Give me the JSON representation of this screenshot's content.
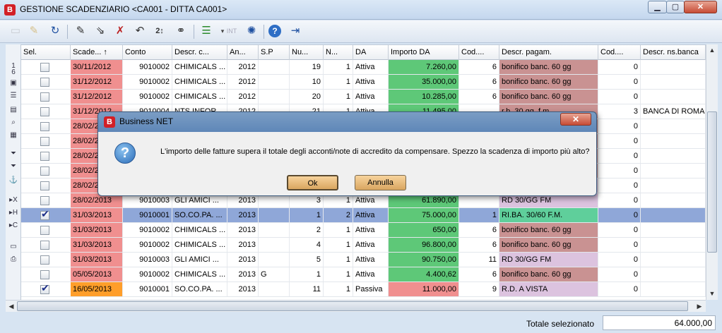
{
  "window": {
    "title": "GESTIONE SCADENZIARIO <CA001 - DITTA CA001>",
    "app_icon": "B",
    "min_label": "▁",
    "max_label": "▢",
    "close_label": "✕"
  },
  "left_strip": {
    "top_number_a": "1",
    "top_number_b": "6"
  },
  "columns": [
    "Sel.",
    "Scade... ↑",
    "Conto",
    "Descr. c...",
    "An...",
    "S.P",
    "Nu...",
    "N...",
    "DA",
    "Importo DA",
    "Cod....",
    "Descr. pagam.",
    "Cod....",
    "Descr. ns.banca"
  ],
  "rows": [
    {
      "sel": false,
      "date": "30/11/2012",
      "date_color": "red",
      "conto": "9010002",
      "descr": "CHIMICALS ...",
      "anno": "2012",
      "sp": "",
      "num": "19",
      "n": "1",
      "da": "Attiva",
      "importo": "7.260,00",
      "imp_color": "green",
      "codpag": "6",
      "pagam": "bonifico banc. 60 gg",
      "pag_color": "rose",
      "codbanca": "0",
      "banca": ""
    },
    {
      "sel": false,
      "date": "31/12/2012",
      "date_color": "red",
      "conto": "9010002",
      "descr": "CHIMICALS ...",
      "anno": "2012",
      "sp": "",
      "num": "10",
      "n": "1",
      "da": "Attiva",
      "importo": "35.000,00",
      "imp_color": "green",
      "codpag": "6",
      "pagam": "bonifico banc. 60 gg",
      "pag_color": "rose",
      "codbanca": "0",
      "banca": ""
    },
    {
      "sel": false,
      "date": "31/12/2012",
      "date_color": "red",
      "conto": "9010002",
      "descr": "CHIMICALS ...",
      "anno": "2012",
      "sp": "",
      "num": "20",
      "n": "1",
      "da": "Attiva",
      "importo": "10.285,00",
      "imp_color": "green",
      "codpag": "6",
      "pagam": "bonifico banc. 60 gg",
      "pag_color": "rose",
      "codbanca": "0",
      "banca": ""
    },
    {
      "sel": false,
      "date": "31/12/2012",
      "date_color": "red",
      "conto": "9010004",
      "descr": "NTS INFOR...",
      "anno": "2012",
      "sp": "",
      "num": "21",
      "n": "1",
      "da": "Attiva",
      "importo": "11.495,00",
      "imp_color": "green",
      "codpag": "",
      "pagam": "r.b. 30 gg. f.m.",
      "pag_color": "rose",
      "codbanca": "3",
      "banca": "BANCA DI ROMAG"
    },
    {
      "sel": false,
      "date": "28/02/2013",
      "date_color": "red",
      "conto": "",
      "descr": "",
      "anno": "",
      "sp": "",
      "num": "",
      "n": "",
      "da": "",
      "importo": "",
      "imp_color": "green",
      "codpag": "",
      "pagam": "",
      "pag_color": "rose",
      "codbanca": "0",
      "banca": ""
    },
    {
      "sel": false,
      "date": "28/02/2013",
      "date_color": "red",
      "conto": "",
      "descr": "",
      "anno": "",
      "sp": "",
      "num": "",
      "n": "",
      "da": "",
      "importo": "",
      "imp_color": "green",
      "codpag": "",
      "pagam": "",
      "pag_color": "rose",
      "codbanca": "0",
      "banca": ""
    },
    {
      "sel": false,
      "date": "28/02/2013",
      "date_color": "red",
      "conto": "",
      "descr": "",
      "anno": "",
      "sp": "",
      "num": "",
      "n": "",
      "da": "",
      "importo": "",
      "imp_color": "green",
      "codpag": "",
      "pagam": "",
      "pag_color": "rose",
      "codbanca": "0",
      "banca": ""
    },
    {
      "sel": false,
      "date": "28/02/2013",
      "date_color": "red",
      "conto": "",
      "descr": "",
      "anno": "",
      "sp": "",
      "num": "",
      "n": "",
      "da": "",
      "importo": "",
      "imp_color": "green",
      "codpag": "",
      "pagam": "",
      "pag_color": "rose",
      "codbanca": "0",
      "banca": ""
    },
    {
      "sel": false,
      "date": "28/02/2013",
      "date_color": "red",
      "conto": "",
      "descr": "",
      "anno": "",
      "sp": "",
      "num": "",
      "n": "",
      "da": "",
      "importo": "",
      "imp_color": "green",
      "codpag": "",
      "pagam": "",
      "pag_color": "lilac",
      "codbanca": "0",
      "banca": ""
    },
    {
      "sel": false,
      "date": "28/02/2013",
      "date_color": "red",
      "conto": "9010003",
      "descr": "GLI AMICI ...",
      "anno": "2013",
      "sp": "",
      "num": "3",
      "n": "1",
      "da": "Attiva",
      "importo": "61.890,00",
      "imp_color": "green",
      "codpag": "",
      "pagam": "RD 30/GG FM",
      "pag_color": "lilac",
      "codbanca": "0",
      "banca": ""
    },
    {
      "sel": true,
      "selected": true,
      "date": "31/03/2013",
      "date_color": "red",
      "conto": "9010001",
      "descr": "SO.CO.PA. ...",
      "anno": "2013",
      "sp": "",
      "num": "1",
      "n": "2",
      "da": "Attiva",
      "importo": "75.000,00",
      "imp_color": "green",
      "codpag": "1",
      "pagam": "RI.BA. 30/60 F.M.",
      "pag_color": "teal",
      "codbanca": "0",
      "banca": ""
    },
    {
      "sel": false,
      "date": "31/03/2013",
      "date_color": "red",
      "conto": "9010002",
      "descr": "CHIMICALS ...",
      "anno": "2013",
      "sp": "",
      "num": "2",
      "n": "1",
      "da": "Attiva",
      "importo": "650,00",
      "imp_color": "green",
      "codpag": "6",
      "pagam": "bonifico banc. 60 gg",
      "pag_color": "rose",
      "codbanca": "0",
      "banca": ""
    },
    {
      "sel": false,
      "date": "31/03/2013",
      "date_color": "red",
      "conto": "9010002",
      "descr": "CHIMICALS ...",
      "anno": "2013",
      "sp": "",
      "num": "4",
      "n": "1",
      "da": "Attiva",
      "importo": "96.800,00",
      "imp_color": "green",
      "codpag": "6",
      "pagam": "bonifico banc. 60 gg",
      "pag_color": "rose",
      "codbanca": "0",
      "banca": ""
    },
    {
      "sel": false,
      "date": "31/03/2013",
      "date_color": "red",
      "conto": "9010003",
      "descr": "GLI AMICI ...",
      "anno": "2013",
      "sp": "",
      "num": "5",
      "n": "1",
      "da": "Attiva",
      "importo": "90.750,00",
      "imp_color": "green",
      "codpag": "11",
      "pagam": "RD 30/GG FM",
      "pag_color": "lilac",
      "codbanca": "0",
      "banca": ""
    },
    {
      "sel": false,
      "date": "05/05/2013",
      "date_color": "red",
      "conto": "9010002",
      "descr": "CHIMICALS ...",
      "anno": "2013",
      "sp": "G",
      "num": "1",
      "n": "1",
      "da": "Attiva",
      "importo": "4.400,62",
      "imp_color": "green",
      "codpag": "6",
      "pagam": "bonifico banc. 60 gg",
      "pag_color": "rose",
      "codbanca": "0",
      "banca": ""
    },
    {
      "sel": true,
      "date": "16/05/2013",
      "date_color": "orange",
      "conto": "9010001",
      "descr": "SO.CO.PA. ...",
      "anno": "2013",
      "sp": "",
      "num": "11",
      "n": "1",
      "da": "Passiva",
      "importo": "11.000,00",
      "imp_color": "pink",
      "codpag": "9",
      "pagam": "R.D. A VISTA",
      "pag_color": "lilac",
      "codbanca": "0",
      "banca": ""
    }
  ],
  "status": {
    "label": "Totale selezionato",
    "value": "64.000,00"
  },
  "dialog": {
    "title": "Business NET",
    "icon": "B",
    "question_icon": "?",
    "close_label": "✕",
    "message": "L'importo delle fatture supera il totale degli acconti/note di accredito da compensare. Spezzo la scadenza di importo più alto?",
    "ok_label": "Ok",
    "cancel_label": "Annulla"
  }
}
